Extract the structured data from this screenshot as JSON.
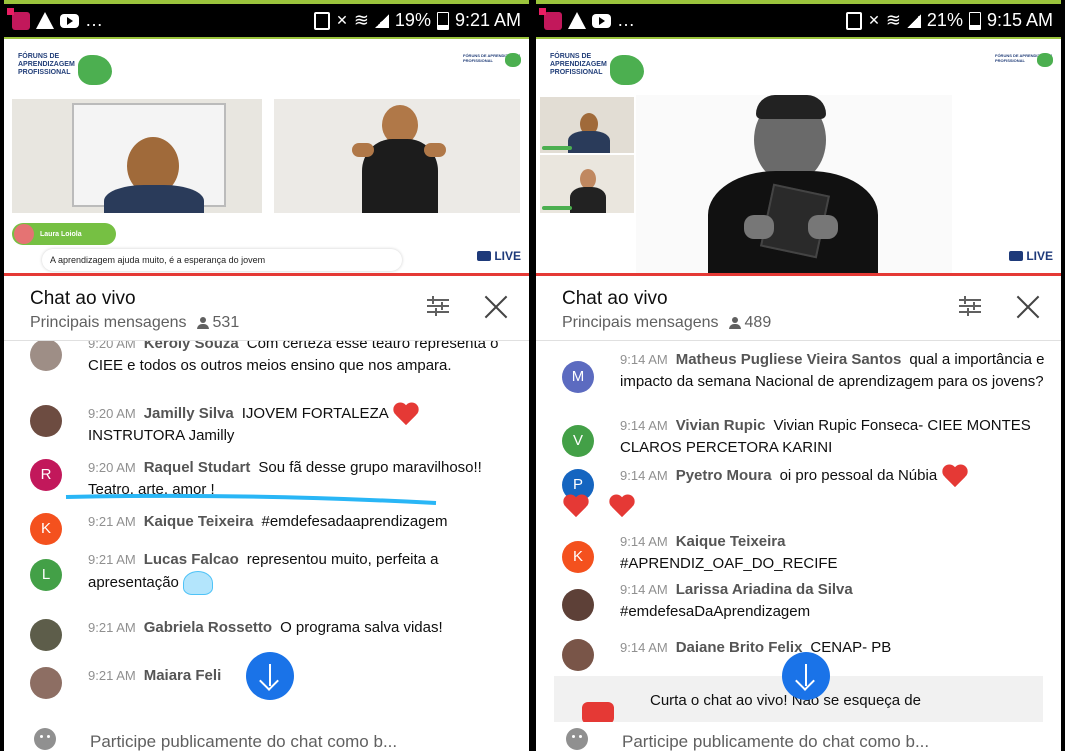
{
  "left": {
    "status": {
      "battery": "19%",
      "time": "9:21 AM"
    },
    "video": {
      "logo_text": "FÓRUNS DE APRENDIZAGEM PROFISSIONAL",
      "logo_small_text": "FÓRUNS DE APRENDIZAGEM PROFISSIONAL",
      "name_chip": "Laura Loiola",
      "caption": "A aprendizagem ajuda muito, é a esperança do jovem",
      "live": "LIVE"
    },
    "chat": {
      "title": "Chat ao vivo",
      "subtitle": "Principais mensagens",
      "viewers": "531"
    },
    "messages": [
      {
        "time": "9:20 AM",
        "author": "Keroly Souza",
        "text": "Com certeza esse teatro representa o CIEE e todos os outros meios ensino que nos ampara.",
        "avatar": "",
        "color": "#9e8e86"
      },
      {
        "time": "9:20 AM",
        "author": "Jamilly Silva",
        "text": "IJOVEM FORTALEZA",
        "text2": "INSTRUTORA Jamilly",
        "avatar": "",
        "color": "#6d4c41"
      },
      {
        "time": "9:20 AM",
        "author": "Raquel Studart",
        "text": "Sou fã desse grupo maravilhoso!! Teatro, arte, amor !",
        "avatar": "R",
        "color": "#c2185b"
      },
      {
        "time": "9:21 AM",
        "author": "Kaique Teixeira",
        "text": "#emdefesadaaprendizagem",
        "avatar": "K",
        "color": "#f4511e"
      },
      {
        "time": "9:21 AM",
        "author": "Lucas Falcao",
        "text": "representou muito, perfeita a apresentação",
        "avatar": "L",
        "color": "#43a047"
      },
      {
        "time": "9:21 AM",
        "author": "Gabriela Rossetto",
        "text": "O programa salva vidas!",
        "avatar": "",
        "color": "#5d5d4a"
      },
      {
        "time": "9:21 AM",
        "author": "Maiara Feli",
        "text": "",
        "avatar": "",
        "color": "#8d6e63"
      }
    ],
    "input_placeholder": "Participe publicamente do chat como b..."
  },
  "right": {
    "status": {
      "battery": "21%",
      "time": "9:15 AM"
    },
    "video": {
      "logo_text": "FÓRUNS DE APRENDIZAGEM PROFISSIONAL",
      "logo_small_text": "FÓRUNS DE APRENDIZAGEM PROFISSIONAL",
      "live": "LIVE"
    },
    "chat": {
      "title": "Chat ao vivo",
      "subtitle": "Principais mensagens",
      "viewers": "489"
    },
    "messages": [
      {
        "time": "9:14 AM",
        "author": "Matheus Pugliese Vieira Santos",
        "text": "qual a importância e impacto da semana Nacional de aprendizagem para os jovens?",
        "avatar": "M",
        "color": "#5c6bc0"
      },
      {
        "time": "9:14 AM",
        "author": "Vivian Rupic",
        "text": "Vivian Rupic Fonseca- CIEE MONTES CLAROS PERCETORA KARINI",
        "avatar": "V",
        "color": "#43a047"
      },
      {
        "time": "9:14 AM",
        "author": "Pyetro Moura",
        "text": "oi pro pessoal da Núbia",
        "avatar": "P",
        "color": "#1565c0"
      },
      {
        "time": "9:14 AM",
        "author": "Kaique Teixeira",
        "text": "#APRENDIZ_OAF_DO_RECIFE",
        "avatar": "K",
        "color": "#f4511e"
      },
      {
        "time": "9:14 AM",
        "author": "Larissa Ariadina da Silva",
        "text": "#emdefesaDaAprendizagem",
        "avatar": "",
        "color": "#5d4037"
      },
      {
        "time": "9:14 AM",
        "author": "Daiane Brito Felix",
        "text": "CENAP- PB",
        "avatar": "",
        "color": "#795548"
      }
    ],
    "banner": "Curta o chat ao vivo! Não se esqueça de",
    "input_placeholder": "Participe publicamente do chat como b..."
  }
}
